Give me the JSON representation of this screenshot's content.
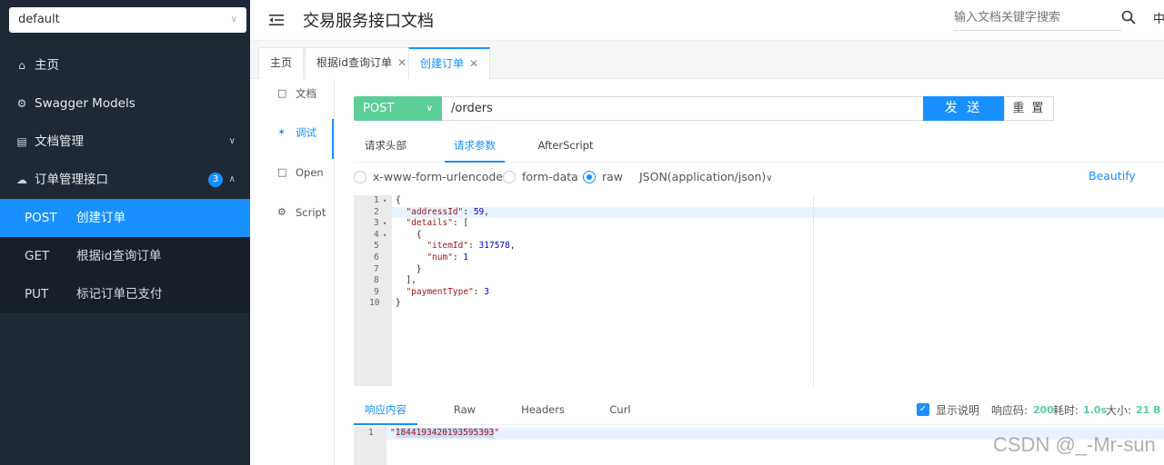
{
  "sidebar": {
    "group_select": "default",
    "items": [
      {
        "label": "主页",
        "icon": "home-icon"
      },
      {
        "label": "Swagger Models",
        "icon": "models-icon"
      },
      {
        "label": "文档管理",
        "icon": "document-icon"
      },
      {
        "label": "订单管理接口",
        "icon": "cloud-icon",
        "badge": "3"
      }
    ],
    "apis": [
      {
        "method": "POST",
        "title": "创建订单"
      },
      {
        "method": "GET",
        "title": "根据id查询订单"
      },
      {
        "method": "PUT",
        "title": "标记订单已支付"
      }
    ]
  },
  "header": {
    "title": "交易服务接口文档",
    "search_placeholder": "输入文档关键字搜索",
    "lang": "中"
  },
  "tabs": [
    {
      "label": "主页"
    },
    {
      "label": "根据id查询订单"
    },
    {
      "label": "创建订单"
    }
  ],
  "side_tabs": [
    {
      "label": "文档"
    },
    {
      "label": "调试"
    },
    {
      "label": "Open"
    },
    {
      "label": "Script"
    }
  ],
  "request": {
    "method": "POST",
    "url": "/orders",
    "send_label": "发 送",
    "reset_label": "重 置",
    "tabs": [
      "请求头部",
      "请求参数",
      "AfterScript"
    ],
    "body_types": [
      "x-www-form-urlencoded",
      "form-data",
      "raw"
    ],
    "content_type": "JSON(application/json)",
    "beautify_label": "Beautify",
    "line_numbers": [
      "1",
      "2",
      "3",
      "4",
      "5",
      "6",
      "7",
      "8",
      "9",
      "10"
    ]
  },
  "response": {
    "tabs": [
      "响应内容",
      "Raw",
      "Headers",
      "Curl"
    ],
    "show_desc_label": "显示说明",
    "code_label": "响应码:",
    "code_value": "200",
    "time_label": "耗时:",
    "time_value": "1.0s",
    "size_label": "大小:",
    "size_value": "21 B",
    "line_number": "1",
    "body": "1844193420193595393"
  },
  "watermark": "CSDN @_-Mr-sun",
  "colors": {
    "accent": "#1890ff",
    "post_green": "#5ccf98",
    "sidebar_bg": "#1f2936"
  }
}
